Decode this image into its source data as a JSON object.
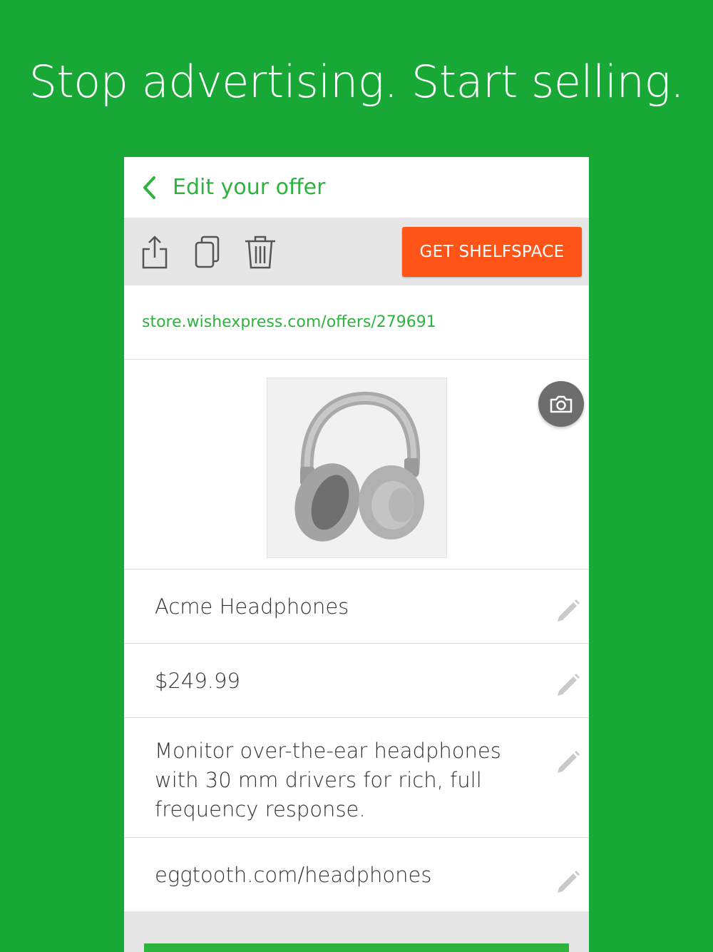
{
  "headline": "Stop advertising. Start selling.",
  "appbar": {
    "title": "Edit your offer"
  },
  "toolbar": {
    "icons": [
      "share-icon",
      "copy-icon",
      "trash-icon"
    ],
    "cta_label": "GET SHELFSPACE"
  },
  "offer": {
    "url": "store.wishexpress.com/offers/279691",
    "name": "Acme Headphones",
    "price": "$249.99",
    "description": "Monitor over-the-ear headphones with 30 mm drivers for rich, full frequency response.",
    "link": "eggtooth.com/headphones"
  },
  "colors": {
    "background": "#17a836",
    "accent": "#2eb33e",
    "cta": "#ff5418",
    "toolbar": "#e6e6e6"
  }
}
